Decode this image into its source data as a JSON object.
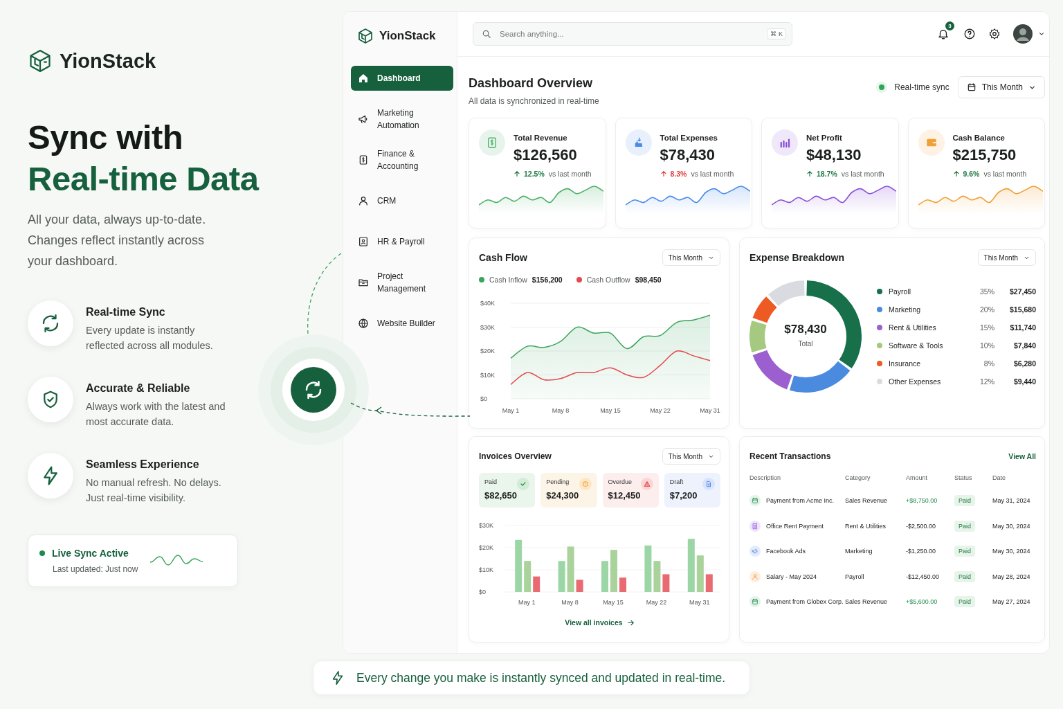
{
  "brand": {
    "name": "YionStack"
  },
  "hero": {
    "title_line_1": "Sync with",
    "title_line_2": "Real-time Data",
    "description": "All your data, always up-to-date. Changes reflect instantly across your dashboard."
  },
  "features": [
    {
      "kind": "sync",
      "title": "Real-time Sync",
      "text": "Every update is instantly reflected across all modules."
    },
    {
      "kind": "shield",
      "title": "Accurate & Reliable",
      "text": "Always work with the latest and most accurate data."
    },
    {
      "kind": "bolt",
      "title": "Seamless Experience",
      "text": "No manual refresh. No delays. Just real-time visibility."
    }
  ],
  "live_status": {
    "title": "Live Sync Active",
    "updated": "Last updated: Just now",
    "on": true
  },
  "app": {
    "brand": "YionStack",
    "sidebar": {
      "items": [
        {
          "kind": "home",
          "label": "Dashboard",
          "selected": true
        },
        {
          "kind": "megaphone",
          "label": "Marketing Automation",
          "selected": false
        },
        {
          "kind": "dollar",
          "label": "Finance & Accounting",
          "selected": false
        },
        {
          "kind": "person",
          "label": "CRM",
          "selected": false
        },
        {
          "kind": "badge",
          "label": "HR & Payroll",
          "selected": false
        },
        {
          "kind": "folder",
          "label": "Project Management",
          "selected": false
        },
        {
          "kind": "globe",
          "label": "Website Builder",
          "selected": false
        }
      ]
    },
    "search": {
      "placeholder": "Search anything...",
      "shortcut": "⌘ K"
    },
    "notifications": {
      "count": "3"
    },
    "header": {
      "title": "Dashboard Overview",
      "subtitle": "All data is synchronized in real-time",
      "sync_label": "Real-time sync",
      "sync_on": true,
      "period": "This Month"
    },
    "kpis": [
      {
        "title": "Total Revenue",
        "value": "$126,560",
        "change": "12.5%",
        "note": "vs last month",
        "kind": "positive",
        "color": "#4caf68"
      },
      {
        "title": "Total Expenses",
        "value": "$78,430",
        "change": "8.3%",
        "note": "vs last month",
        "kind": "negative",
        "color": "#4a8be8"
      },
      {
        "title": "Net Profit",
        "value": "$48,130",
        "change": "18.7%",
        "note": "vs last month",
        "kind": "positive",
        "color": "#8a4fd8"
      },
      {
        "title": "Cash Balance",
        "value": "$215,750",
        "change": "9.6%",
        "note": "vs last month",
        "kind": "positive",
        "color": "#f0a035"
      }
    ],
    "cash_flow": {
      "title": "Cash Flow",
      "period": "This Month",
      "legend": [
        {
          "total": "$156,200"
        },
        {
          "total": "$98,450"
        }
      ],
      "chart_data": {
        "type": "area",
        "stacked": false,
        "grid": true,
        "categories": [
          "May 1",
          null,
          null,
          "May 8",
          null,
          null,
          "May 15",
          null,
          null,
          "May 22",
          null,
          null,
          "May 31"
        ],
        "series": [
          {
            "name": "Cash Inflow",
            "color": "#3aa55c",
            "values": [
              17,
              22,
              21.5,
              24,
              30,
              27.5,
              27.5,
              21,
              26,
              26.5,
              32,
              33,
              35
            ]
          },
          {
            "name": "Cash Outflow",
            "type": "line",
            "color": "#e5484d",
            "values": [
              6,
              11,
              8,
              8.5,
              11,
              11,
              13,
              10,
              9,
              14,
              20,
              18,
              16
            ]
          }
        ],
        "ylim": [
          0,
          40
        ],
        "yticks": [
          {
            "value": 0,
            "label": "$0"
          },
          {
            "value": 10,
            "label": "$10K"
          },
          {
            "value": 20,
            "label": "$20K"
          },
          {
            "value": 30,
            "label": "$30K"
          },
          {
            "value": 40,
            "label": "$40K"
          }
        ]
      }
    },
    "expense": {
      "title": "Expense Breakdown",
      "period": "This Month",
      "total": "$78,430",
      "total_label": "Total",
      "legend": [
        {
          "percent": "35%",
          "amount": "$27,450",
          "color": "#17704a"
        },
        {
          "percent": "20%",
          "amount": "$15,680",
          "color": "#4a8be0"
        },
        {
          "percent": "15%",
          "amount": "$11,740",
          "color": "#9b5fcf"
        },
        {
          "percent": "10%",
          "amount": "$7,840",
          "color": "#a5c97f"
        },
        {
          "percent": "8%",
          "amount": "$6,280",
          "color": "#ee5a24"
        },
        {
          "percent": "12%",
          "amount": "$9,440",
          "color": "#d9dbe0"
        }
      ],
      "chart_data": {
        "type": "donut",
        "categories": [
          "Payroll",
          "Marketing",
          "Rent & Utilities",
          "Software & Tools",
          "Insurance",
          "Other Expenses"
        ],
        "values": [
          35,
          20,
          15,
          10,
          8,
          12
        ]
      }
    },
    "invoices": {
      "title": "Invoices Overview",
      "period": "This Month",
      "tiles": [
        {
          "kind": "paid",
          "label": "Paid",
          "value": "$82,650"
        },
        {
          "kind": "pending",
          "label": "Pending",
          "value": "$24,300"
        },
        {
          "kind": "overdue",
          "label": "Overdue",
          "value": "$12,450"
        },
        {
          "kind": "draft",
          "label": "Draft",
          "value": "$7,200"
        }
      ],
      "chart_data": {
        "type": "bar",
        "categories": [
          "May 1",
          "May 8",
          "May 15",
          "May 22",
          "May 31"
        ],
        "series": [
          {
            "color": "#9dd6a6",
            "values": [
              23.5,
              14,
              14,
              21,
              24
            ]
          },
          {
            "color": "#a9d39a",
            "values": [
              14,
              20.5,
              19,
              14,
              16.5
            ]
          },
          {
            "color": "#e96a70",
            "values": [
              7,
              5.5,
              6.5,
              8,
              8
            ]
          }
        ],
        "ylim": [
          0,
          30
        ],
        "yticks": [
          {
            "value": 0,
            "label": "$0"
          },
          {
            "value": 10,
            "label": "$10K"
          },
          {
            "value": 20,
            "label": "$20K"
          },
          {
            "value": 30,
            "label": "$30K"
          }
        ]
      },
      "link": "View all invoices"
    },
    "transactions": {
      "title": "Recent Transactions",
      "link": "View All",
      "columns": [
        "Description",
        "Category",
        "Amount",
        "Status",
        "Date"
      ],
      "rows": [
        {
          "description": "Payment from Acme Inc.",
          "category": "Sales Revenue",
          "amount": "+$8,750.00",
          "kind": "credit",
          "status": "Paid",
          "date": "May 31, 2024"
        },
        {
          "description": "Office Rent Payment",
          "category": "Rent & Utilities",
          "amount": "-$2,500.00",
          "kind": "debit",
          "status": "Paid",
          "date": "May 30, 2024"
        },
        {
          "description": "Facebook Ads",
          "category": "Marketing",
          "amount": "-$1,250.00",
          "kind": "debit",
          "status": "Paid",
          "date": "May 30, 2024"
        },
        {
          "description": "Salary - May 2024",
          "category": "Payroll",
          "amount": "-$12,450.00",
          "kind": "debit",
          "status": "Paid",
          "date": "May 28, 2024"
        },
        {
          "description": "Payment from Globex Corp.",
          "category": "Sales Revenue",
          "amount": "+$5,600.00",
          "kind": "credit",
          "status": "Paid",
          "date": "May 27, 2024"
        }
      ]
    }
  },
  "banner": {
    "text": "Every change you make is instantly synced and updated in real-time."
  }
}
